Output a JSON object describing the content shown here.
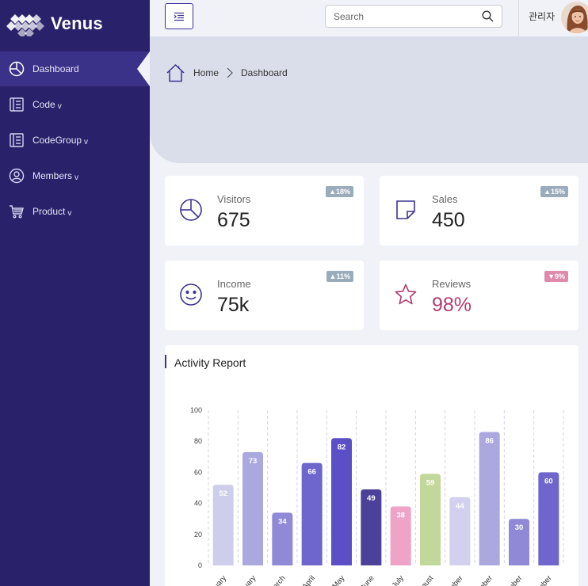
{
  "app": {
    "name": "Venus"
  },
  "sidebar": {
    "items": [
      {
        "label": "Dashboard",
        "caret": "",
        "icon": "pie-chart-icon",
        "active": true
      },
      {
        "label": "Code",
        "caret": "v",
        "icon": "book-icon",
        "active": false
      },
      {
        "label": "CodeGroup",
        "caret": "v",
        "icon": "book-icon",
        "active": false
      },
      {
        "label": "Members",
        "caret": "v",
        "icon": "user-icon",
        "active": false
      },
      {
        "label": "Product",
        "caret": "v",
        "icon": "cart-icon",
        "active": false
      }
    ]
  },
  "topbar": {
    "search_placeholder": "Search",
    "username": "관리자"
  },
  "breadcrumb": {
    "home": "Home",
    "current": "Dashboard"
  },
  "stats": [
    {
      "label": "Visitors",
      "value": "675",
      "badge": "18%",
      "trend": "up",
      "icon": "pie-chart-icon"
    },
    {
      "label": "Sales",
      "value": "450",
      "badge": "15%",
      "trend": "up",
      "icon": "sticky-note-icon"
    },
    {
      "label": "Income",
      "value": "75k",
      "badge": "11%",
      "trend": "up",
      "icon": "smiley-icon"
    },
    {
      "label": "Reviews",
      "value": "98%",
      "badge": "9%",
      "trend": "down",
      "icon": "star-icon"
    }
  ],
  "report": {
    "title": "Activity Report"
  },
  "chart_data": {
    "type": "bar",
    "categories": [
      "January",
      "February",
      "March",
      "April",
      "May",
      "June",
      "July",
      "August",
      "September",
      "October",
      "November",
      "December"
    ],
    "values": [
      52,
      73,
      34,
      66,
      82,
      49,
      38,
      59,
      44,
      86,
      30,
      60
    ],
    "colors": [
      "#cfcdec",
      "#aba8e0",
      "#8f89d6",
      "#6e66cc",
      "#5a4fc6",
      "#4b4199",
      "#efa3c6",
      "#c2d89b",
      "#d2d0ee",
      "#aba8e0",
      "#8f89d6",
      "#6e66cc"
    ],
    "ylim": [
      0,
      100
    ],
    "yticks": [
      0,
      20,
      40,
      60,
      80,
      100
    ],
    "grid": "vertical-dashed"
  }
}
